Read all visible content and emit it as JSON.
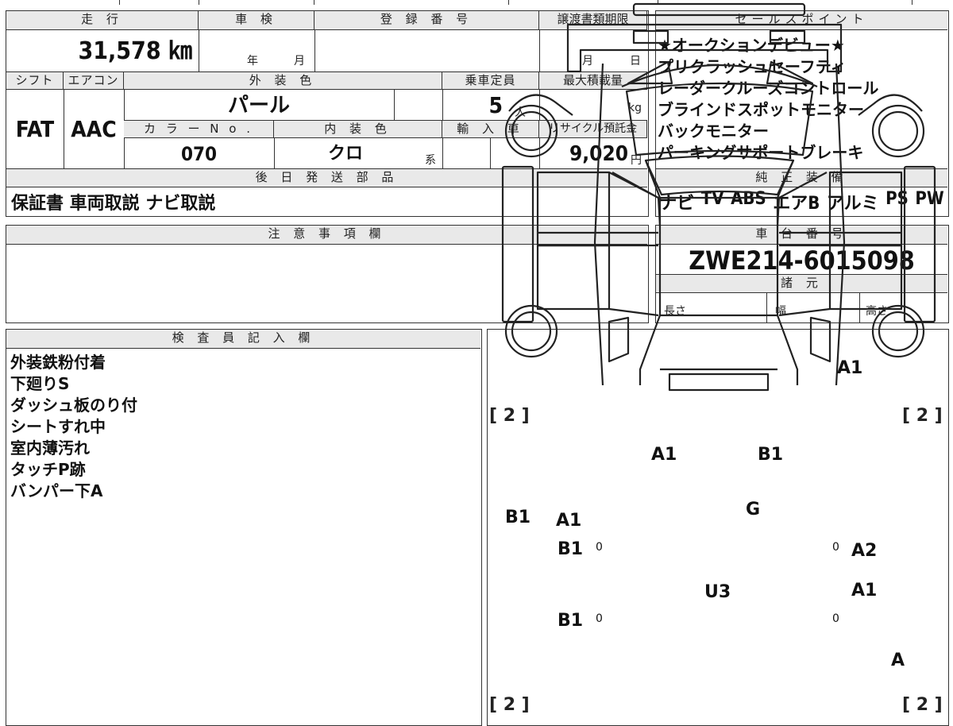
{
  "vehicle": {
    "mileage_label": "走 行",
    "mileage": "31,578 ㎞",
    "inspection_label": "車 検",
    "inspection_year_unit": "年",
    "inspection_month_unit": "月",
    "registration_label": "登 録 番 号",
    "transfer_deadline_label": "譲渡書類期限",
    "transfer_month_unit": "月",
    "transfer_day_unit": "日",
    "shift_label": "シフト",
    "shift": "FAT",
    "aircon_label": "エアコン",
    "aircon": "AAC",
    "exterior_color_label": "外 装 色",
    "exterior_color": "パール",
    "capacity_label": "乗車定員",
    "capacity": "5",
    "capacity_unit": "人",
    "max_load_label": "最大積載量",
    "max_load_unit": "kg",
    "color_no_label": "カ ラ ー N o .",
    "color_no": "070",
    "interior_color_label": "内 装 色",
    "interior_color": "クロ",
    "interior_suffix": "系",
    "import_label": "輸 入 車",
    "recycle_label": "リサイクル預託金",
    "recycle_fee": "9,020",
    "recycle_unit": "円",
    "later_parts_label": "後 日 発 送 部 品",
    "later_parts": "保証書 車両取説 ナビ取説"
  },
  "sales_points": {
    "label": "セールスポイント",
    "items": [
      "★オークションデビュー★",
      "プリクラッシュセーフティ",
      "レーダークルーズコントロール",
      "ブラインドスポットモニター",
      "バックモニター",
      "パーキングサポートブレーキ"
    ]
  },
  "equipment": {
    "label": "純 正 装 備",
    "items": [
      "ナビ",
      "TV",
      "ABS",
      "エアB",
      "アルミ",
      "PS",
      "PW"
    ]
  },
  "notes": {
    "label": "注 意 事 項 欄"
  },
  "chassis": {
    "label": "車 台 番 号",
    "number": "ZWE214-6015098"
  },
  "specs": {
    "label": "諸 元",
    "length": "長さ",
    "width": "幅",
    "height": "高さ"
  },
  "inspector": {
    "label": "検 査 員 記 入 欄",
    "comments": [
      "外装鉄粉付着",
      "下廻りS",
      "ダッシュ板のり付",
      "シートすれ中",
      "室内薄汚れ",
      "タッチP跡",
      "バンパー下A"
    ]
  },
  "diagram": {
    "tread_label": "[ 2 ]",
    "zero": "0",
    "marks": {
      "front_bumper": "A1",
      "hood_left": "A1",
      "hood_right": "B1",
      "windshield": "G",
      "left_fender": "B1",
      "front_left_door_1": "A1",
      "front_left_door_2": "B1",
      "rear_left_door": "B1",
      "front_right_door": "A2",
      "rear_right_door": "A1",
      "roof": "U3",
      "rear_right_wheel": "A"
    }
  }
}
